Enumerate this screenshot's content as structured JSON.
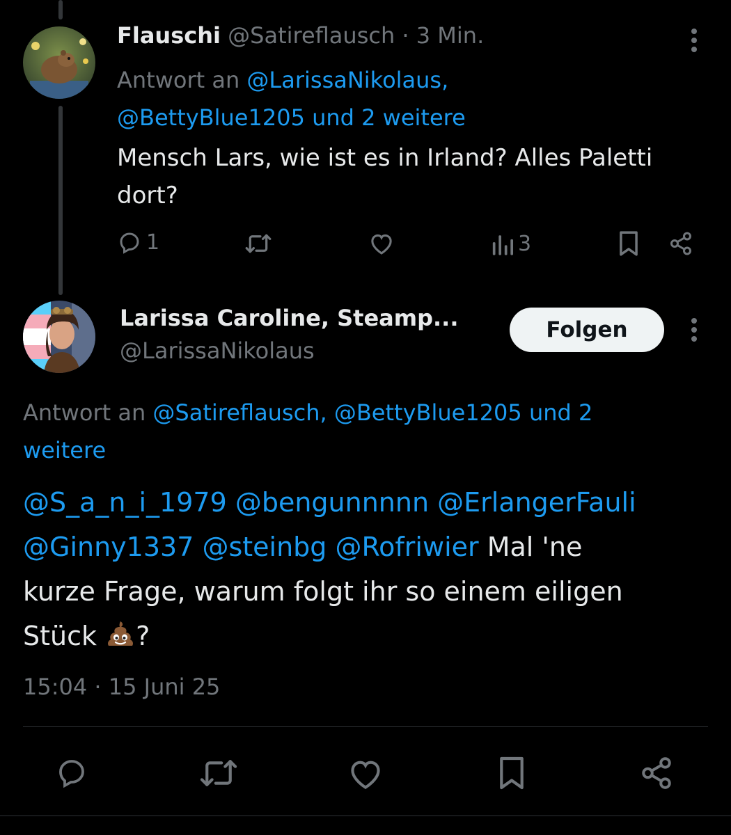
{
  "reply1": {
    "display_name": "Flauschi",
    "handle": "@Satireflausch",
    "separator": "·",
    "time_ago": "3 Min.",
    "reply_prefix": "Antwort an",
    "reply_line1_links": "@LarissaNikolaus,",
    "reply_line2_links": "@BettyBlue1205 und 2 weitere",
    "text_line1": "Mensch Lars, wie ist es in Irland? Alles Paletti",
    "text_line2": "dort?",
    "reply_count": "1",
    "view_count": "3"
  },
  "main_post": {
    "display_name": "Larissa Caroline, Steamp...",
    "handle": "@LarissaNikolaus",
    "follow_label": "Folgen",
    "reply_prefix": "Antwort an",
    "reply_line1_links": "@Satireflausch, @BettyBlue1205 und 2",
    "reply_line2_links": "weitere",
    "mentions_line1": "@S_a_n_i_1979 @bengunnnnn @ErlangerFauli",
    "mentions_line2": "@Ginny1337 @steinbg @Rofriwier",
    "text_line2_tail": " Mal 'ne",
    "text_line3": "kurze Frage, warum folgt ihr so einem eiligen",
    "text_line4_start": "Stück ",
    "text_line4_end": "?",
    "timestamp": "15:04 · 15 Juni 25"
  },
  "icons": {
    "reply": "speech-bubble-icon",
    "repost": "repost-arrows-icon",
    "like": "heart-icon",
    "views": "bar-chart-icon",
    "bookmark": "bookmark-icon",
    "share": "share-nodes-icon",
    "more": "more-vertical-dots-icon",
    "emoji": "pile-of-poo-emoji"
  },
  "colors": {
    "background": "#000000",
    "text": "#e7e9ea",
    "muted": "#71767b",
    "link": "#1d9bf0",
    "follow_button_bg": "#eff3f4"
  }
}
